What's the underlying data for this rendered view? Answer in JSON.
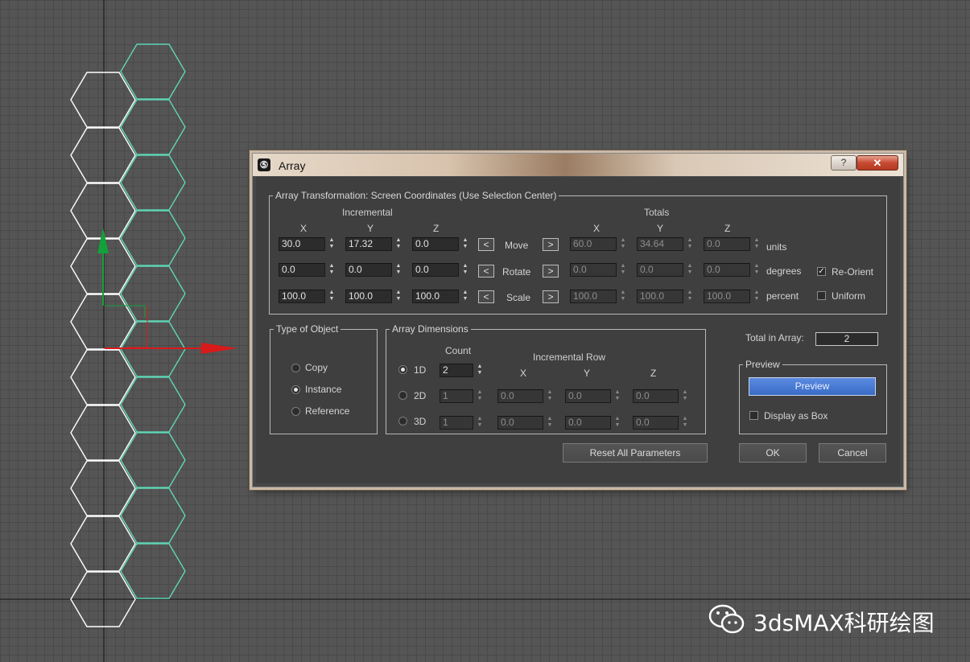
{
  "window": {
    "title": "Array",
    "help_glyph": "?",
    "close_glyph": "✕"
  },
  "transform": {
    "legend": "Array Transformation: Screen Coordinates (Use Selection Center)",
    "incremental_header": "Incremental",
    "totals_header": "Totals",
    "axis_x": "X",
    "axis_y": "Y",
    "axis_z": "Z",
    "move": {
      "label": "Move",
      "inc": [
        "30.0",
        "17.32",
        "0.0"
      ],
      "tot": [
        "60.0",
        "34.64",
        "0.0"
      ],
      "unit": "units"
    },
    "rotate": {
      "label": "Rotate",
      "inc": [
        "0.0",
        "0.0",
        "0.0"
      ],
      "tot": [
        "0.0",
        "0.0",
        "0.0"
      ],
      "unit": "degrees"
    },
    "scale": {
      "label": "Scale",
      "inc": [
        "100.0",
        "100.0",
        "100.0"
      ],
      "tot": [
        "100.0",
        "100.0",
        "100.0"
      ],
      "unit": "percent"
    },
    "left_arrow": "<",
    "right_arrow": ">",
    "reorient_label": "Re-Orient",
    "reorient_checked": true,
    "uniform_label": "Uniform",
    "uniform_checked": false
  },
  "object_type": {
    "legend": "Type of Object",
    "options": [
      "Copy",
      "Instance",
      "Reference"
    ],
    "selected": "Instance"
  },
  "dimensions": {
    "legend": "Array Dimensions",
    "count_header": "Count",
    "incremental_row_header": "Incremental Row",
    "x": "X",
    "y": "Y",
    "z": "Z",
    "d1": {
      "label": "1D",
      "count": "2"
    },
    "d2": {
      "label": "2D",
      "count": "1",
      "x": "0.0",
      "y": "0.0",
      "z": "0.0"
    },
    "d3": {
      "label": "3D",
      "count": "1",
      "x": "0.0",
      "y": "0.0",
      "z": "0.0"
    },
    "selected": "1D"
  },
  "total": {
    "label": "Total in Array:",
    "value": "2"
  },
  "preview": {
    "legend": "Preview",
    "button": "Preview",
    "display_as_box": "Display as Box",
    "display_as_box_checked": false
  },
  "buttons": {
    "reset": "Reset All Parameters",
    "ok": "OK",
    "cancel": "Cancel"
  },
  "watermark": {
    "text": "3dsMAX科研绘图"
  },
  "colors": {
    "hex_selected": "#ffffff",
    "hex_instance": "#5fd4b4",
    "axis_x": "#d91a1a",
    "axis_y": "#14a03a",
    "accent": "#3a6cc6"
  }
}
